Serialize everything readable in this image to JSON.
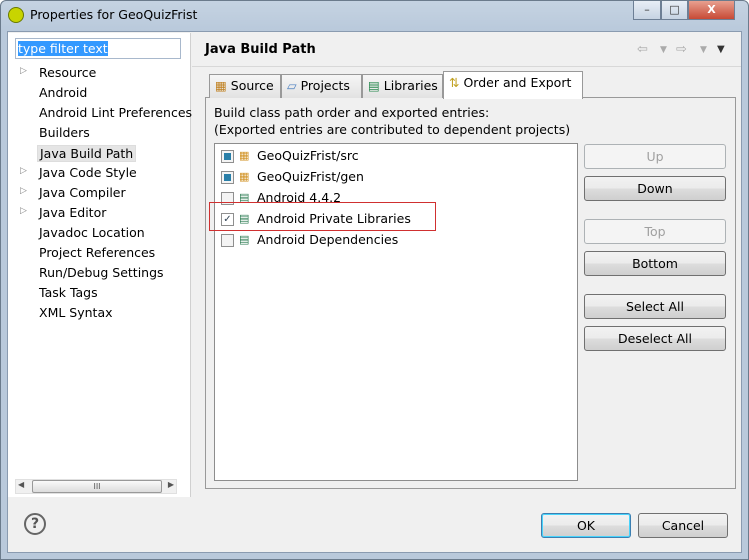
{
  "window": {
    "title": "Properties for GeoQuizFrist",
    "minimize": "–",
    "maximize": "□",
    "close": "X"
  },
  "sidebar": {
    "filter_value": "type filter text",
    "items": [
      {
        "label": "Resource",
        "expandable": true
      },
      {
        "label": "Android",
        "expandable": false
      },
      {
        "label": "Android Lint Preferences",
        "expandable": false
      },
      {
        "label": "Builders",
        "expandable": false
      },
      {
        "label": "Java Build Path",
        "expandable": false,
        "selected": true
      },
      {
        "label": "Java Code Style",
        "expandable": true
      },
      {
        "label": "Java Compiler",
        "expandable": true
      },
      {
        "label": "Java Editor",
        "expandable": true
      },
      {
        "label": "Javadoc Location",
        "expandable": false
      },
      {
        "label": "Project References",
        "expandable": false
      },
      {
        "label": "Run/Debug Settings",
        "expandable": false
      },
      {
        "label": "Task Tags",
        "expandable": false
      },
      {
        "label": "XML Syntax",
        "expandable": false
      }
    ],
    "scroll_grip": "III"
  },
  "header": {
    "title": "Java Build Path",
    "back": "⇦",
    "forward": "⇨",
    "menu": "▼"
  },
  "tabs": [
    {
      "label": "Source"
    },
    {
      "label": "Projects"
    },
    {
      "label": "Libraries"
    },
    {
      "label": "Order and Export",
      "active": true
    }
  ],
  "order": {
    "desc1": "Build class path order and exported entries:",
    "desc2": "(Exported entries are contributed to dependent projects)",
    "entries": [
      {
        "label": "GeoQuizFrist/src",
        "checked": "fixed",
        "icon": "source-folder"
      },
      {
        "label": "GeoQuizFrist/gen",
        "checked": "fixed",
        "icon": "source-folder"
      },
      {
        "label": "Android 4.4.2",
        "checked": false,
        "icon": "library"
      },
      {
        "label": "Android Private Libraries",
        "checked": true,
        "icon": "library"
      },
      {
        "label": "Android Dependencies",
        "checked": false,
        "icon": "library"
      }
    ],
    "buttons": {
      "up": "Up",
      "down": "Down",
      "top": "Top",
      "bottom": "Bottom",
      "select_all": "Select All",
      "deselect_all": "Deselect All"
    }
  },
  "footer": {
    "help": "?",
    "ok": "OK",
    "cancel": "Cancel"
  },
  "colors": {
    "highlight_box": "#d03030",
    "selection": "#3399ff"
  }
}
